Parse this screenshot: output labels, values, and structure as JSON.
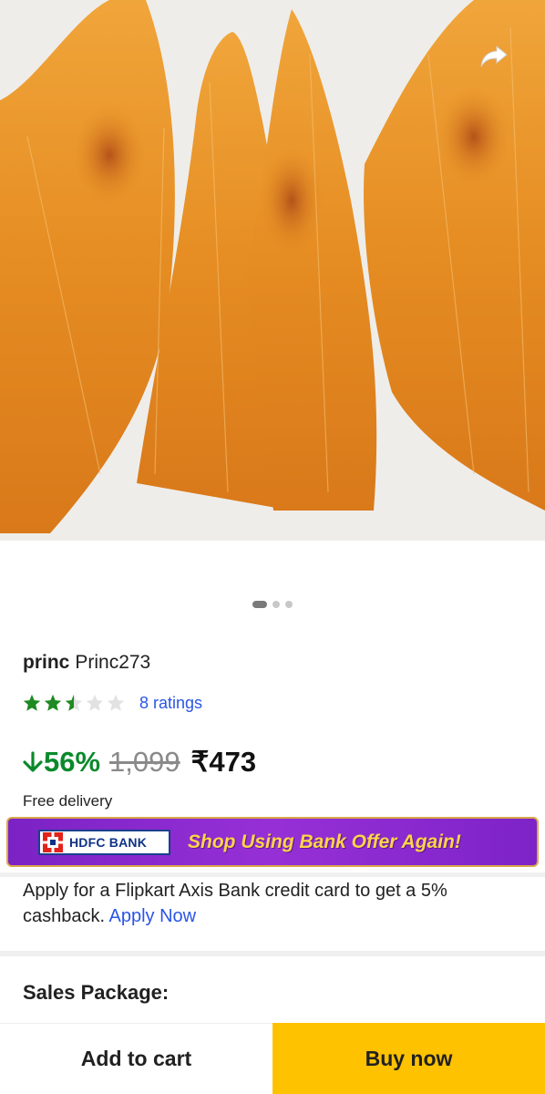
{
  "product": {
    "brand": "princ",
    "name": "Princ273",
    "rating_value": 2.5,
    "rating_max": 5,
    "ratings_count_label": "8 ratings",
    "discount_label": "56%",
    "mrp": "1,099",
    "price": "₹473",
    "delivery": "Free delivery"
  },
  "gallery": {
    "image_count": 3,
    "active_index": 0
  },
  "banner": {
    "bank_name": "HDFC BANK",
    "text": "Shop Using Bank Offer Again!"
  },
  "offer": {
    "text": "Apply for a Flipkart Axis Bank credit card to get a 5% cashback.",
    "link": "Apply Now"
  },
  "sales_package": {
    "label": "Sales Package:"
  },
  "actions": {
    "add_to_cart": "Add to cart",
    "buy_now": "Buy now"
  },
  "icons": {
    "share": "share-icon",
    "discount": "arrow-down-icon",
    "star": "star-icon"
  },
  "colors": {
    "buy_now": "#ffc200",
    "discount": "#0b8a2b",
    "link": "#2a55e5",
    "banner": "#8a2ad0",
    "star": "#1f8a21"
  }
}
